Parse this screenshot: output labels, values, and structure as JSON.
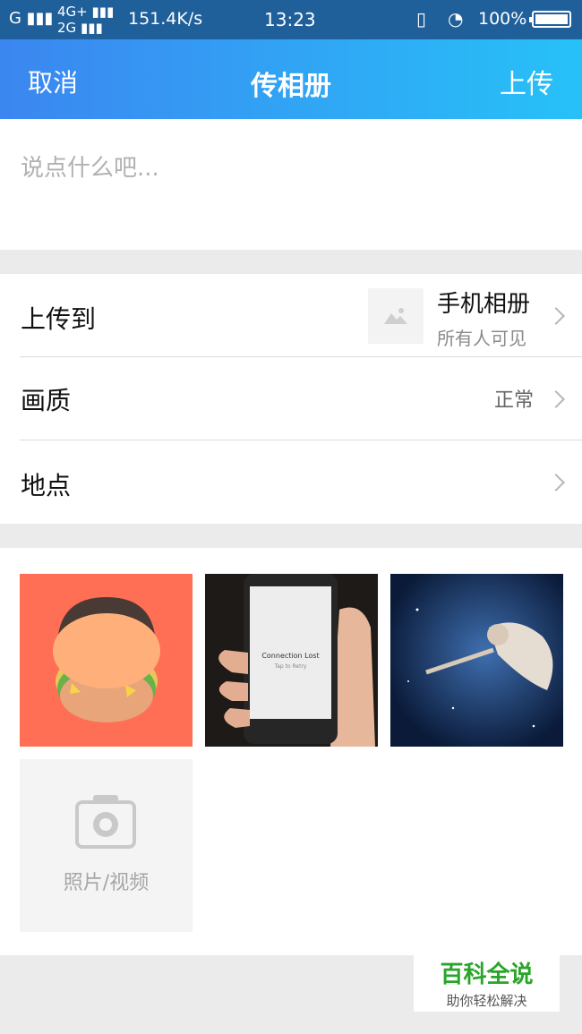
{
  "status_bar": {
    "signal_left": "G",
    "network": [
      "4G+",
      "2G"
    ],
    "speed": "151.4K/s",
    "time": "13:23",
    "battery_pct": "100%",
    "icons": [
      "signal-icon",
      "vibrate-icon",
      "wifi-icon",
      "battery-icon"
    ]
  },
  "header": {
    "cancel_label": "取消",
    "title": "传相册",
    "upload_label": "上传"
  },
  "composer": {
    "placeholder": "说点什么吧..."
  },
  "settings": {
    "upload_to_label": "上传到",
    "album_name": "手机相册",
    "album_privacy": "所有人可见",
    "quality_label": "画质",
    "quality_value": "正常",
    "location_label": "地点"
  },
  "photos": {
    "items": [
      {
        "icon": "burger-illustration"
      },
      {
        "icon": "phone-connection-lost-image",
        "text": "Connection Lost",
        "subtext": "Tap to Retry"
      },
      {
        "icon": "space-figure-image"
      }
    ],
    "add_label": "照片/视频"
  },
  "watermark": {
    "title": "百科全说",
    "subtitle": "助你轻松解决"
  },
  "colors": {
    "header_start": "#3b86f0",
    "header_end": "#27c1f8",
    "status_bar": "#1f5f9a",
    "watermark_green": "#2aa52a"
  }
}
